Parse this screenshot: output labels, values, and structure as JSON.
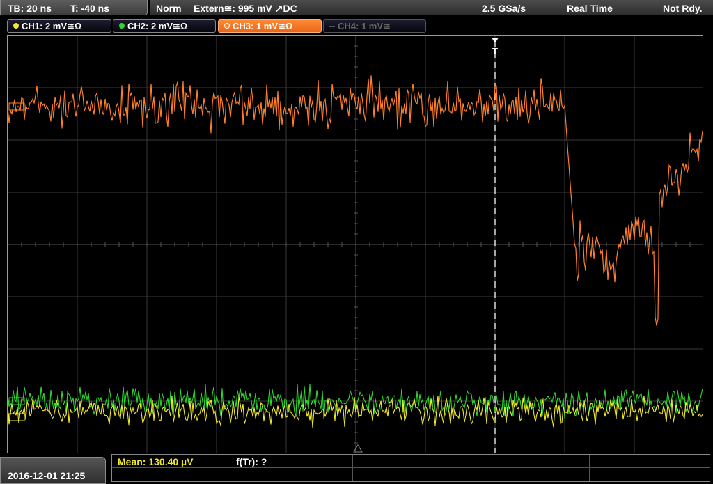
{
  "header": {
    "timebase": "TB: 20 ns",
    "trigger_time": "T: -40 ns",
    "trigger_mode": "Norm",
    "trigger_source": "Extern≅: 995 mV ↗DC",
    "sample_rate": "2.5 GSa/s",
    "acq_mode": "Real Time",
    "status": "Not Rdy."
  },
  "channels": [
    {
      "label": "CH1: 2 mV≅Ω",
      "color": "#f2ea2b",
      "state": "on"
    },
    {
      "label": "CH2: 2 mV≅Ω",
      "color": "#2fd62f",
      "state": "on"
    },
    {
      "label": "CH3: 1 mV≅Ω",
      "color": "#ff7f2a",
      "state": "active"
    },
    {
      "label": "CH4: 1 mV≅",
      "color": "#777777",
      "state": "off"
    }
  ],
  "trigger_marker": "T",
  "footer": {
    "datetime": "2016-12-01 21:25",
    "measurement_1": "Mean: 130.40 µV",
    "measurement_2": "f(Tr): ?"
  },
  "colors": {
    "ch1": "#f2ea2b",
    "ch2": "#2fd62f",
    "ch3": "#ff7f2a",
    "grid": "#3a3a3a",
    "trigger_line": "#ffffff"
  }
}
